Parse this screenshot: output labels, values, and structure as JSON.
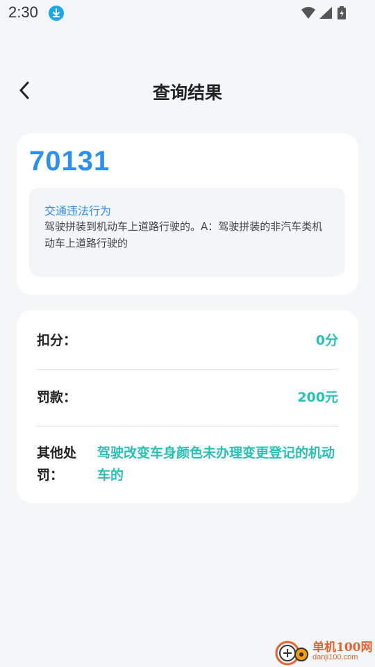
{
  "status_bar": {
    "time": "2:30",
    "icons": [
      "download-icon",
      "wifi-icon",
      "signal-icon",
      "battery-charging-icon"
    ]
  },
  "header": {
    "title": "查询结果",
    "back_icon": "chevron-left-icon"
  },
  "violation": {
    "code": "70131",
    "heading": "交通违法行为",
    "description": "驾驶拼装到机动车上道路行驶的。A：驾驶拼装的非汽车类机动车上道路行驶的"
  },
  "result": {
    "points_label": "扣分：",
    "points_value": "0分",
    "fine_label": "罚款：",
    "fine_value": "200元",
    "other_label": "其他处罚：",
    "other_value": "驾驶改变车身颜色未办理变更登记的机动车的"
  },
  "watermark": {
    "name": "单机100网",
    "url": "danji100.com"
  },
  "colors": {
    "accent_blue": "#2b8ff0",
    "accent_teal": "#27c1b5",
    "background": "#f5f6f8"
  }
}
